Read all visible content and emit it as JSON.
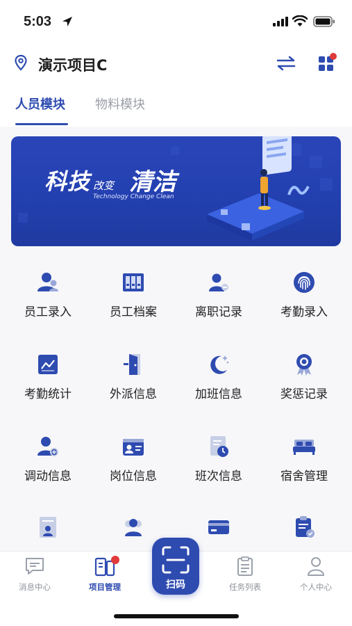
{
  "status_bar": {
    "time": "5:03"
  },
  "header": {
    "project_name": "演示项目C"
  },
  "tabs": [
    {
      "label": "人员模块",
      "active": true
    },
    {
      "label": "物料模块",
      "active": false
    }
  ],
  "banner": {
    "title_part1": "科技",
    "title_part2": "改变",
    "title_part3": "清洁",
    "subtitle": "Technology Change Clean"
  },
  "grid": [
    {
      "label": "员工录入",
      "icon": "user-add-icon"
    },
    {
      "label": "员工档案",
      "icon": "archive-icon"
    },
    {
      "label": "离职记录",
      "icon": "user-leave-icon"
    },
    {
      "label": "考勤录入",
      "icon": "fingerprint-icon"
    },
    {
      "label": "考勤统计",
      "icon": "chart-icon"
    },
    {
      "label": "外派信息",
      "icon": "door-icon"
    },
    {
      "label": "加班信息",
      "icon": "moon-icon"
    },
    {
      "label": "奖惩记录",
      "icon": "medal-icon"
    },
    {
      "label": "调动信息",
      "icon": "user-transfer-icon"
    },
    {
      "label": "岗位信息",
      "icon": "id-card-icon"
    },
    {
      "label": "班次信息",
      "icon": "schedule-icon"
    },
    {
      "label": "宿舍管理",
      "icon": "bed-icon"
    },
    {
      "label": "",
      "icon": "certificate-icon"
    },
    {
      "label": "",
      "icon": "users-icon"
    },
    {
      "label": "",
      "icon": "card-icon"
    },
    {
      "label": "",
      "icon": "clipboard-icon"
    }
  ],
  "bottom_nav": [
    {
      "label": "消息中心",
      "icon": "message-icon",
      "active": false
    },
    {
      "label": "项目管理",
      "icon": "project-icon",
      "active": true,
      "badge": true
    },
    {
      "label": "扫码",
      "icon": "scan-icon",
      "center": true
    },
    {
      "label": "任务列表",
      "icon": "task-list-icon",
      "active": false
    },
    {
      "label": "个人中心",
      "icon": "person-icon",
      "active": false
    }
  ],
  "colors": {
    "primary": "#2e4bb0",
    "badge": "#e03a3a",
    "inactive": "#9a9ea6",
    "background": "#f7f7f9"
  }
}
